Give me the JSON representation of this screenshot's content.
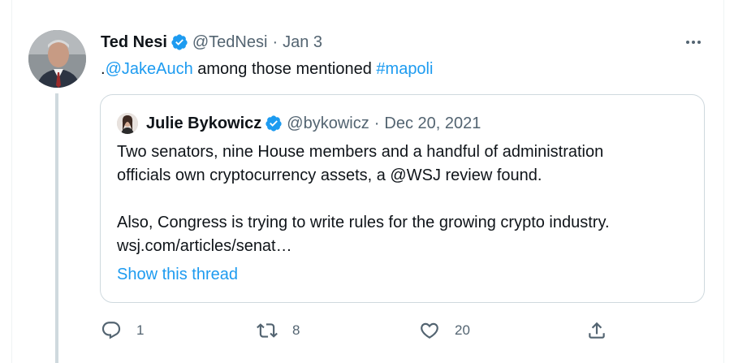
{
  "tweet": {
    "author_name": "Ted Nesi",
    "handle": "@TedNesi",
    "separator": "·",
    "date": "Jan 3",
    "text_prefix": ".",
    "mention": "@JakeAuch",
    "text_middle": " among those mentioned ",
    "hashtag": "#mapoli",
    "icons": {
      "verified": "verified-badge-icon",
      "more": "more-horizontal-icon"
    },
    "colors": {
      "accent": "#1d9bf0",
      "muted": "#536471",
      "text": "#0f1419"
    }
  },
  "quote": {
    "author_name": "Julie Bykowicz",
    "handle": "@bykowicz",
    "separator": "·",
    "date": "Dec 20, 2021",
    "line1": "Two senators, nine House members and a handful of administration",
    "line2": "officials own cryptocurrency assets, a @WSJ review found.",
    "line3": "Also, Congress is trying to write rules for the growing crypto industry.",
    "line4": "wsj.com/articles/senat…",
    "show_thread": "Show this thread"
  },
  "actions": {
    "reply_count": "1",
    "retweet_count": "8",
    "like_count": "20",
    "icons": [
      "reply-icon",
      "retweet-icon",
      "like-icon",
      "share-icon"
    ]
  }
}
